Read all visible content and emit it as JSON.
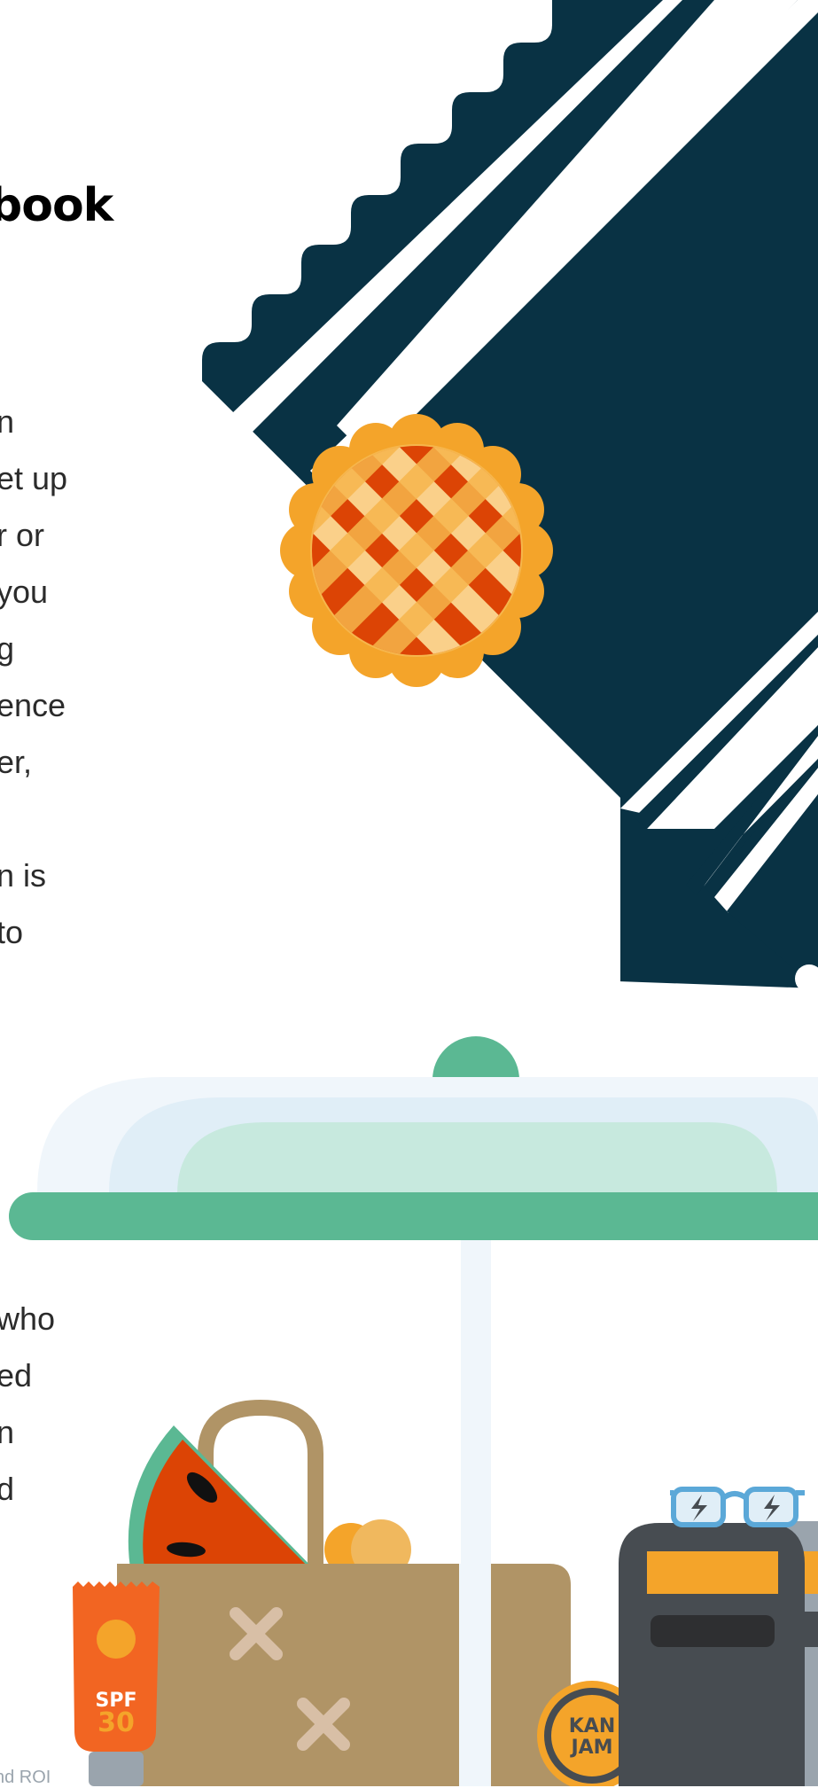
{
  "heading": "book",
  "paragraph_top": [
    "n",
    "et up",
    "r or",
    " you",
    "g",
    "ence",
    "er,",
    "",
    "n is",
    "to"
  ],
  "paragraph_bottom": [
    "who",
    "ed",
    "n",
    "d"
  ],
  "footer_fragment": "nd ROI",
  "illustration": {
    "sunscreen_label": "SPF",
    "sunscreen_number": "30",
    "kanjam_line1": "KAN",
    "kanjam_line2": "JAM"
  },
  "colors": {
    "navy": "#093244",
    "pie_crust": "#f4a42a",
    "pie_filling": "#dc4405",
    "lattice": "#fad08a",
    "umbrella_green": "#5bb893",
    "umbrella_light": "#c7e9de",
    "umbrella_pale": "#e0eef7",
    "basket": "#b09466",
    "sunscreen": "#f26522",
    "cooler": "#474c51"
  }
}
